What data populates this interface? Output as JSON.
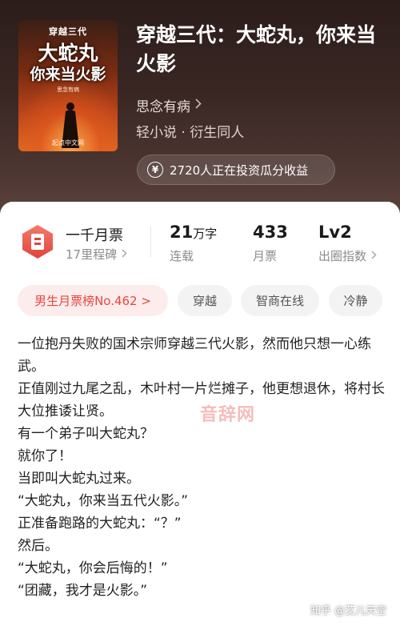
{
  "cover": {
    "subtitle": "穿越三代",
    "title_line1": "大蛇丸",
    "title_line2": "你来当火影",
    "author": "思念有病",
    "publisher": "起点中文网"
  },
  "book": {
    "title": "穿越三代：大蛇丸，你来当火影",
    "author": "思念有病",
    "genre": "轻小说 · 衍生同人"
  },
  "invest": {
    "icon": "yen-circle-icon",
    "text": "2720人正在投资瓜分收益"
  },
  "stats": {
    "ticket_icon": "monthly-ticket-icon",
    "ticket_title": "一千月票",
    "ticket_sub": "17里程碑",
    "words_value": "21",
    "words_unit": "万字",
    "words_label": "连载",
    "votes_value": "433",
    "votes_label": "月票",
    "level_value": "Lv2",
    "level_label": "出圈指数"
  },
  "tags": {
    "rank": "男生月票榜No.462 >",
    "t1": "穿越",
    "t2": "智商在线",
    "t3": "冷静"
  },
  "synopsis": [
    "一位抱丹失败的国术宗师穿越三代火影，然而他只想一心练武。",
    "正值刚过九尾之乱，木叶村一片烂摊子，他更想退休，将村长大位推诿让贤。",
    "有一个弟子叫大蛇丸？",
    "就你了！",
    "当即叫大蛇丸过来。",
    "“大蛇丸，你来当五代火影。”",
    "正准备跑路的大蛇丸：“？”",
    "然后。",
    "“大蛇丸，你会后悔的！”",
    "“团藏，我才是火影。”"
  ],
  "watermarks": {
    "mid": "音辞网",
    "corner": "知乎 @艾儿天空"
  },
  "colors": {
    "accent_red": "#e5483f",
    "header_bg": "#3a2724"
  }
}
